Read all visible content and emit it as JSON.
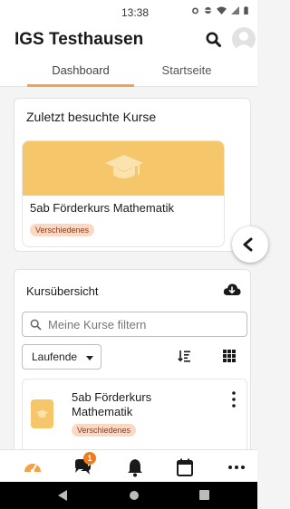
{
  "status_bar": {
    "time": "13:38"
  },
  "header": {
    "site_title": "IGS Testhausen"
  },
  "tabs": [
    {
      "label": "Dashboard",
      "active": true
    },
    {
      "label": "Startseite",
      "active": false
    }
  ],
  "recent_courses": {
    "title": "Zuletzt besuchte Kurse",
    "courses": [
      {
        "name": "5ab Förderkurs Mathematik",
        "category": "Verschiedenes"
      }
    ]
  },
  "course_overview": {
    "title": "Kursübersicht",
    "filter_placeholder": "Meine Kurse filtern",
    "grouping_selected": "Laufende",
    "courses": [
      {
        "name": "5ab Förderkurs Mathematik",
        "category": "Verschiedenes"
      }
    ]
  },
  "bottom_nav": {
    "items": [
      "dashboard-icon",
      "messages-icon",
      "notifications-icon",
      "calendar-icon",
      "more-icon"
    ],
    "messages_badge": "1"
  },
  "colors": {
    "accent": "#f3a24a",
    "course_image": "#f5c66a",
    "badge_bg": "#fbd8c4",
    "badge_text": "#8a3d1a",
    "notification": "#f07c1f"
  }
}
